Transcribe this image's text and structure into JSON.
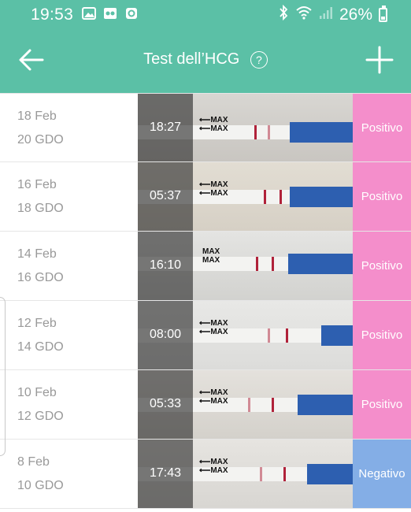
{
  "status_bar": {
    "time": "19:53",
    "battery": "26%"
  },
  "toolbar": {
    "title": "Test dell’HCG",
    "help_symbol": "?"
  },
  "colors": {
    "header": "#5bc0a6",
    "positive": "#f48ecb",
    "negative": "#84aee6"
  },
  "strip_labels": {
    "max": "MAX"
  },
  "tests": [
    {
      "date": "18 Feb",
      "gdo": "20 GDO",
      "time": "18:27",
      "result": "Positivo"
    },
    {
      "date": "16 Feb",
      "gdo": "18 GDO",
      "time": "05:37",
      "result": "Positivo"
    },
    {
      "date": "14 Feb",
      "gdo": "16 GDO",
      "time": "16:10",
      "result": "Positivo"
    },
    {
      "date": "12 Feb",
      "gdo": "14 GDO",
      "time": "08:00",
      "result": "Positivo"
    },
    {
      "date": "10 Feb",
      "gdo": "12 GDO",
      "time": "05:33",
      "result": "Positivo"
    },
    {
      "date": "8 Feb",
      "gdo": "10 GDO",
      "time": "17:43",
      "result": "Negativo"
    }
  ]
}
